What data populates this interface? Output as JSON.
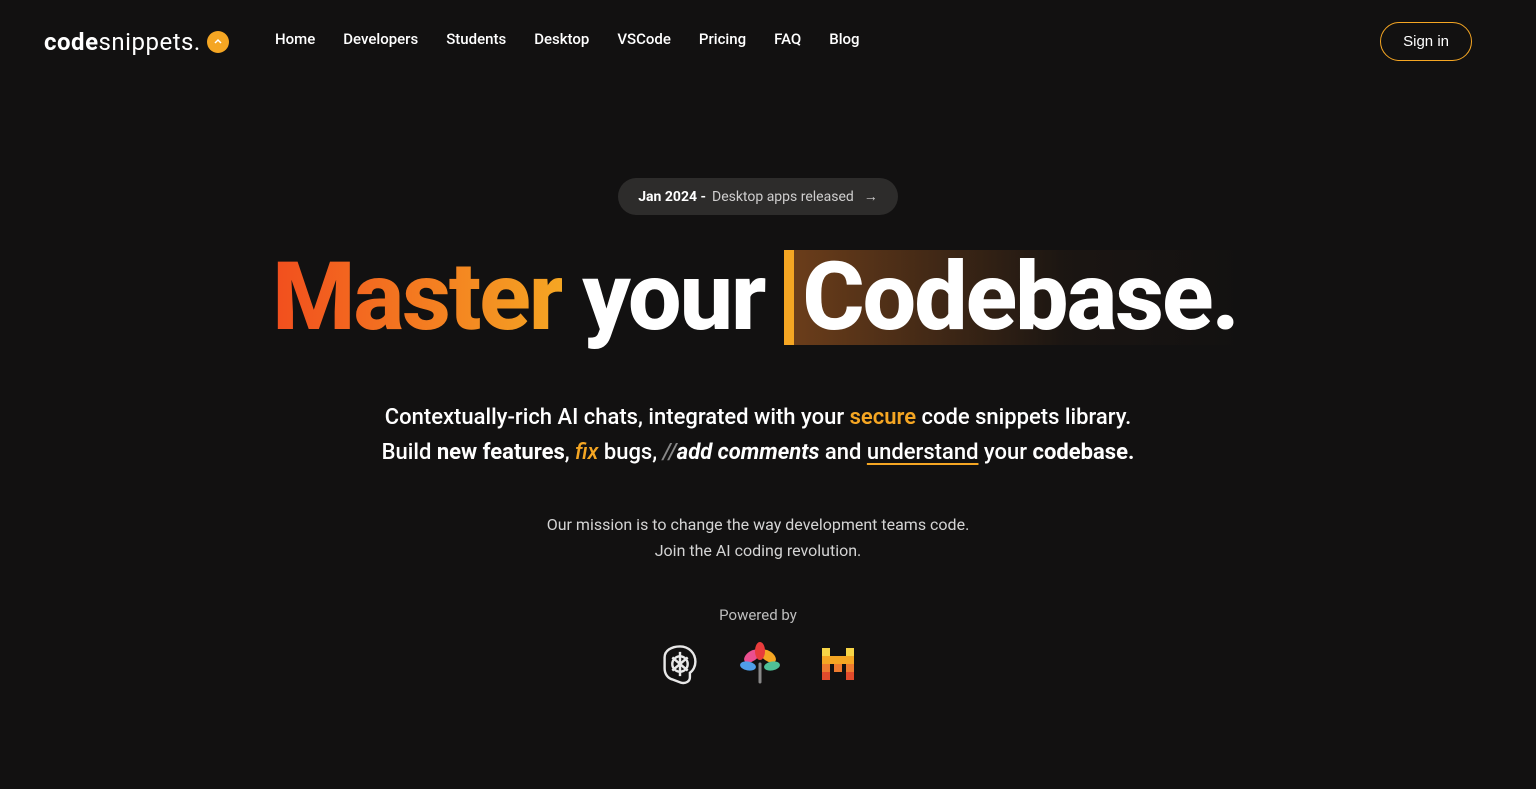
{
  "logo": {
    "prefix": "code",
    "suffix": "snippets."
  },
  "nav": {
    "home": "Home",
    "developers": "Developers",
    "students": "Students",
    "desktop": "Desktop",
    "vscode": "VSCode",
    "pricing": "Pricing",
    "faq": "FAQ",
    "blog": "Blog"
  },
  "signin": "Sign in",
  "pill": {
    "date": "Jan 2024 - ",
    "desc": "Desktop apps released",
    "arrow": "→"
  },
  "headline": {
    "master": "Master",
    "your": "your",
    "codebase": "Codebase."
  },
  "subhead": {
    "line1_pre": "Contextually-rich AI chats, integrated with your ",
    "secure": "secure",
    "line1_post": " code snippets library.",
    "line2_pre": "Build ",
    "newfeatures": "new features",
    "line2_mid1": ", ",
    "fix": "fix",
    "line2_mid2": " bugs, ",
    "comments_pref": "//",
    "comments": "add comments",
    "line2_mid3": " and ",
    "understand": "understand",
    "line2_mid4": " your ",
    "codebase2": "codebase."
  },
  "mission": {
    "line1": "Our mission is to change the way development teams code.",
    "line2": "Join the AI coding revolution."
  },
  "powered": "Powered by"
}
